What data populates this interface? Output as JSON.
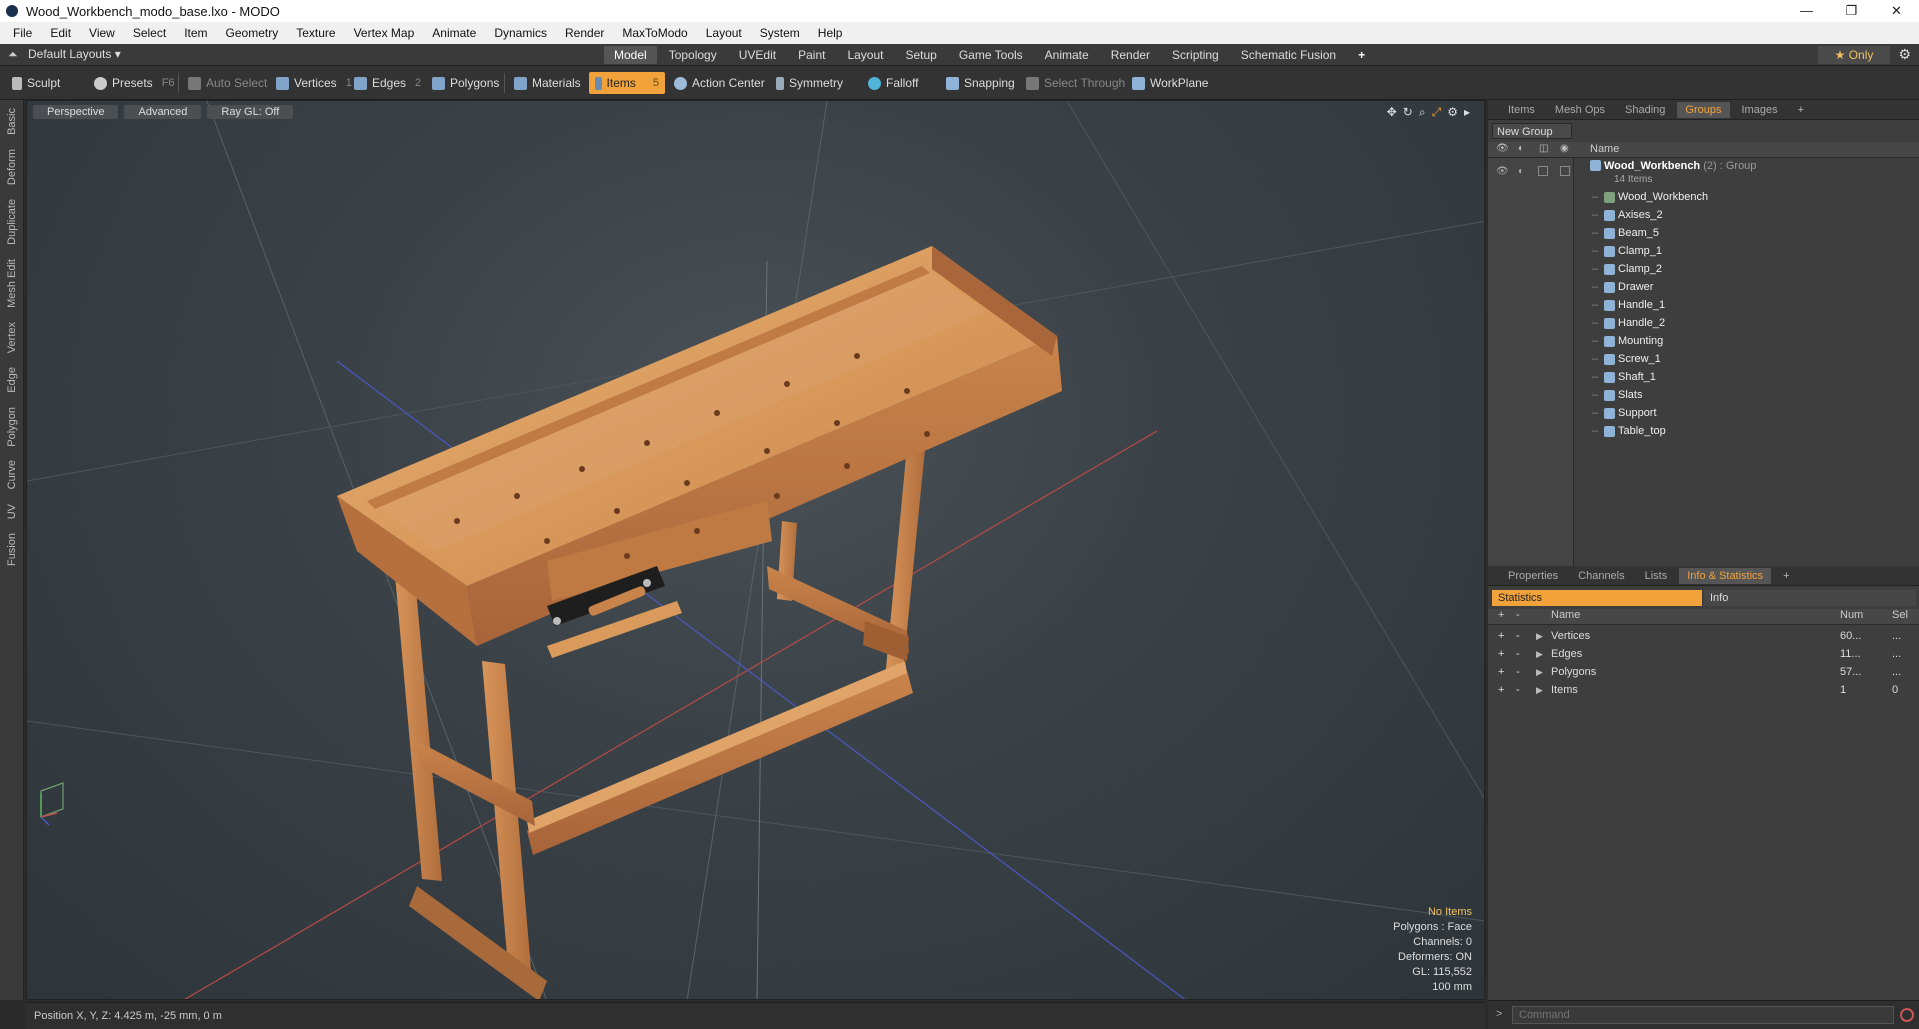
{
  "window": {
    "title": "Wood_Workbench_modo_base.lxo - MODO",
    "minimize": "—",
    "maximize": "❐",
    "close": "✕"
  },
  "menu": [
    "File",
    "Edit",
    "View",
    "Select",
    "Item",
    "Geometry",
    "Texture",
    "Vertex Map",
    "Animate",
    "Dynamics",
    "Render",
    "MaxToModo",
    "Layout",
    "System",
    "Help"
  ],
  "layoutbar": {
    "layout_dropdown": "Default Layouts ▾",
    "tabs": [
      "Model",
      "Topology",
      "UVEdit",
      "Paint",
      "Layout",
      "Setup",
      "Game Tools",
      "Animate",
      "Render",
      "Scripting",
      "Schematic Fusion"
    ],
    "active_tab": "Model",
    "add_tab": "+",
    "only_button": "★ Only"
  },
  "toolbar": {
    "sculpt": "Sculpt",
    "presets": "Presets",
    "presets_key": "F6",
    "auto_select": "Auto Select",
    "vertices": "Vertices",
    "vertices_key": "1",
    "edges": "Edges",
    "edges_key": "2",
    "polygons": "Polygons",
    "materials": "Materials",
    "items": "Items",
    "items_key": "5",
    "action_center": "Action Center",
    "symmetry": "Symmetry",
    "falloff": "Falloff",
    "snapping": "Snapping",
    "select_through": "Select Through",
    "workplane": "WorkPlane"
  },
  "left_tabs": [
    "Basic",
    "Deform",
    "Duplicate",
    "Mesh Edit",
    "Vertex",
    "Edge",
    "Polygon",
    "Curve",
    "UV",
    "Fusion"
  ],
  "viewport": {
    "tabs": [
      "Perspective",
      "Advanced",
      "Ray GL: Off"
    ],
    "info": {
      "no_items": "No Items",
      "polygons": "Polygons : Face",
      "channels": "Channels: 0",
      "deformers": "Deformers: ON",
      "gl": "GL: 115,552",
      "scale": "100 mm"
    }
  },
  "statusbar": {
    "position": "Position X, Y, Z:  4.425 m, -25 mm, 0 m"
  },
  "groups_panel": {
    "tabs": [
      "Items",
      "Mesh Ops",
      "Shading",
      "Groups",
      "Images"
    ],
    "active_tab": "Groups",
    "new_group": "New Group",
    "name_header": "Name",
    "root": {
      "name": "Wood_Workbench",
      "count": "(2)",
      "type": ": Group",
      "items_label": "14 Items"
    },
    "children": [
      "Wood_Workbench",
      "Axises_2",
      "Beam_5",
      "Clamp_1",
      "Clamp_2",
      "Drawer",
      "Handle_1",
      "Handle_2",
      "Mounting",
      "Screw_1",
      "Shaft_1",
      "Slats",
      "Support",
      "Table_top"
    ]
  },
  "stats_panel": {
    "tabs": [
      "Properties",
      "Channels",
      "Lists",
      "Info & Statistics"
    ],
    "active_tab": "Info & Statistics",
    "subtabs": {
      "statistics": "Statistics",
      "info": "Info"
    },
    "headers": {
      "name": "Name",
      "num": "Num",
      "sel": "Sel"
    },
    "rows": [
      {
        "name": "Vertices",
        "num": "60...",
        "sel": "..."
      },
      {
        "name": "Edges",
        "num": "11...",
        "sel": "..."
      },
      {
        "name": "Polygons",
        "num": "57...",
        "sel": "..."
      },
      {
        "name": "Items",
        "num": "1",
        "sel": "0"
      }
    ]
  },
  "command": {
    "prompt": ">",
    "placeholder": "Command"
  }
}
